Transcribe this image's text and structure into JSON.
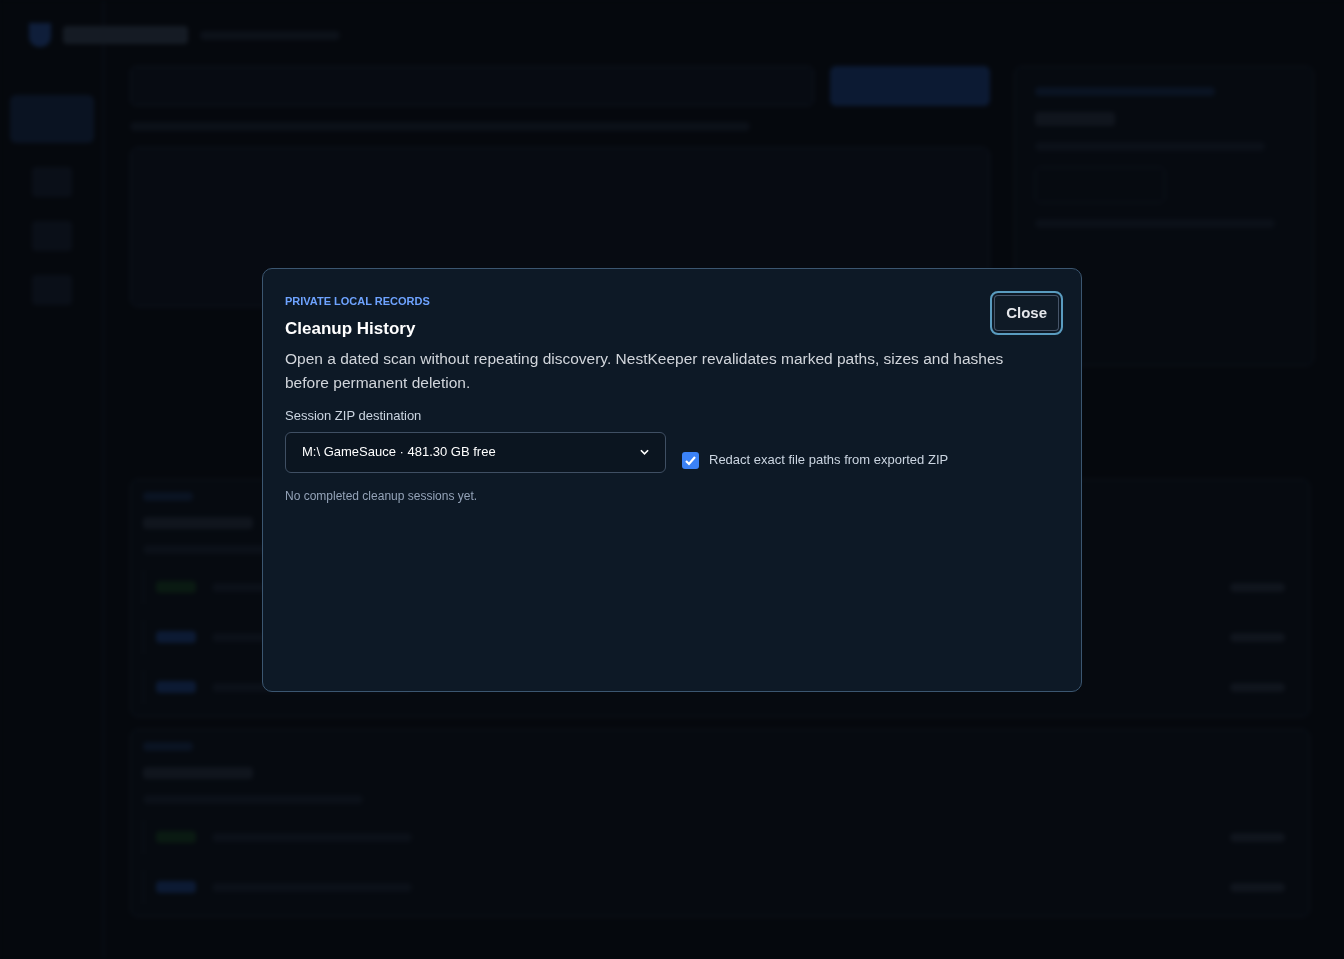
{
  "dialog": {
    "eyebrow": "PRIVATE LOCAL RECORDS",
    "title": "Cleanup History",
    "close": "Close",
    "description": "Open a dated scan without repeating discovery. NestKeeper revalidates marked paths, sizes and hashes before permanent deletion.",
    "zip_label": "Session ZIP destination",
    "zip_value": "M:\\ GameSauce · 481.30 GB free",
    "redact": {
      "label": "Redact exact file paths from exported ZIP",
      "checked": true
    },
    "empty": "No completed cleanup sessions yet."
  }
}
